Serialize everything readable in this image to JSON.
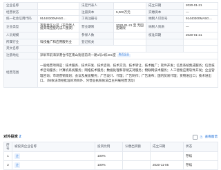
{
  "info": {
    "r1": {
      "l1": "企业名称",
      "v1": "",
      "l2": "法定代表人",
      "v2": "",
      "l3": "成立日期",
      "v3": "2020-01-21"
    },
    "r2": {
      "l1": "经营状态",
      "v1": "",
      "l2": "注册资本",
      "v2": "5,000万元",
      "l3": "实缴资本",
      "v3": "—"
    },
    "r3": {
      "l1": "统一社会信用代码",
      "v1": "91440300MA5G…",
      "l2": "工商注册号",
      "v2": "",
      "l3": "纳税人识别号",
      "v3": "91440300MA5G…"
    },
    "r4": {
      "l1": "企业类型",
      "v1": "有限责任公司（非自然人投资或控股的法人独资）",
      "l2": "营业期限",
      "v2": "2020-01-21 至 无固定期限",
      "l3": "纳税人资质",
      "v3": "—"
    },
    "r5": {
      "l1": "人员规模",
      "v1": "",
      "l2": "参保人数",
      "v2": "",
      "l3": "核准日期",
      "v3": "2020-01-21"
    },
    "r6": {
      "l1": "所属行业",
      "v1": "科技推广和应用服务业",
      "l2": "登记机关",
      "v2": "",
      "l3": "",
      "v3": ""
    },
    "r7": {
      "l1": "英文名称",
      "v1": "",
      "l2": "",
      "v2": ""
    },
    "r8": {
      "l1": "注册地址",
      "v1": "深圳市前海深港合作区南山街道前湾一路1号A栋201室",
      "tag": "附近企业"
    },
    "r9": {
      "l1": "经营范围",
      "v1": "一般经营项目是：技术服务、技术开发、技术咨询、技术交流、技术转让、技术推广；软件开发；信息系统集成服务；信息技术咨询服务；计算机系统服务；网络技术服务；数据处理和存储支持服务；物联网技术服务；人工智能应用软件开发；企业管理咨询；市场营销策划；会议及展览服务；广告设计、代理；广告制作；广告发布；国内贸易代理；货物进出口；技术进出口。（除依法须经批准的项目外，凭营业执照依法自主开展经营活动）"
    }
  },
  "invest": {
    "title": "对外投资",
    "count": "2",
    "right_link": "查看图谱",
    "cols": [
      "序号",
      "被投资企业名称",
      "投资比例",
      "认缴出资额",
      "成立日期",
      "状态"
    ],
    "rows": [
      {
        "idx": "1",
        "name": "",
        "ratio": "100%",
        "amount": "",
        "date": "",
        "status": "存续"
      },
      {
        "idx": "2",
        "name": "",
        "ratio": "100%",
        "amount": "",
        "date": "2020-11-05",
        "status": "存续"
      }
    ]
  }
}
